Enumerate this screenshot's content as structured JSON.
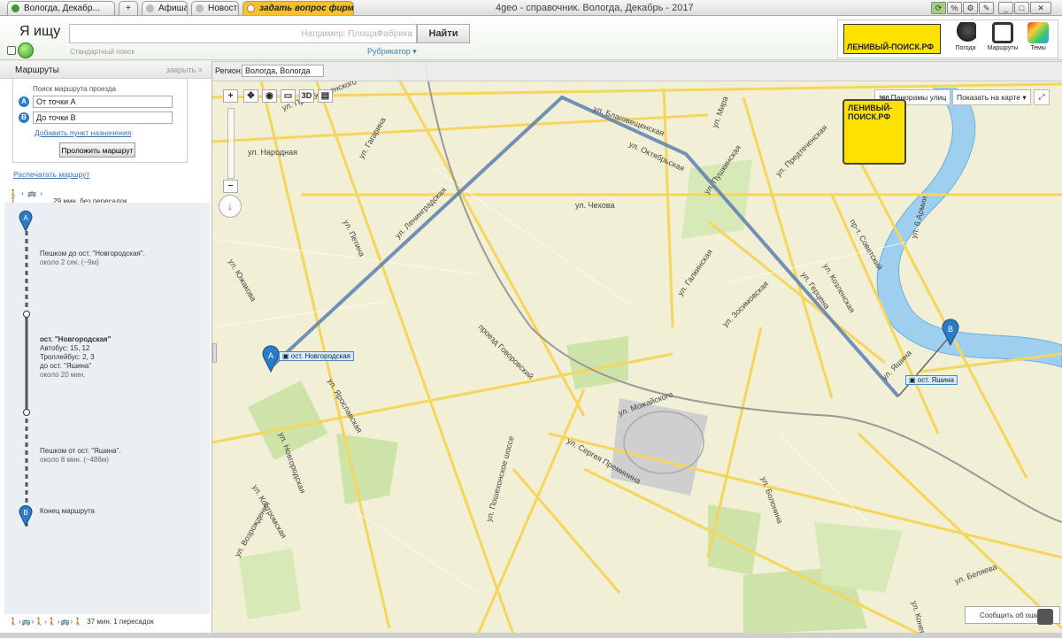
{
  "browser": {
    "tabs": [
      {
        "label": "Вологда, Декабр..."
      },
      {
        "label": "+"
      },
      {
        "label": "Афиша"
      },
      {
        "label": "Новости"
      },
      {
        "label": "задать вопрос фирмам"
      }
    ],
    "window_title": "4geo - справочник. Вологда, Декабрь - 2017"
  },
  "header": {
    "logo_text": "Я ищу",
    "search_placeholder": "Например: ПлощаФабрика",
    "find_label": "Найти",
    "standard_search_label": "Стандартный поиск",
    "rubricator_label": "Рубрикатор ▾",
    "banner_text": "ЛЕНИВЫЙ-ПОИСК.РФ",
    "weather_label": "Погода",
    "routes_label": "Маршруты",
    "themes_label": "Темы"
  },
  "panel": {
    "title": "Маршруты",
    "close_label": "закрыть ×",
    "search_title": "Поиск маршрута проезда",
    "from_point": "От точки А",
    "to_point": "До точки В",
    "point_a": "A",
    "point_b": "B",
    "add_destination": "Добавить пункт назначения",
    "build_route": "Проложить маршрут",
    "print_route": "Распечатать маршрут",
    "summary_top": "29 мин. без пересадок",
    "summary_bottom": "37 мин. 1 пересадок",
    "icons_top": "🚶 › 🚌 › 🚶",
    "icons_bottom": "🚶›🚌›🚶›🚶›🚌›🚶",
    "steps": [
      {
        "title": "Пешком до ост. \"Новгородская\".",
        "sub": "около 2 сек. (~9м)"
      },
      {
        "title": "ост. \"Новгородская\"",
        "line1": "Автобус: 15, 12",
        "line2": "Троллейбус: 2, 3",
        "line3": "до ост. \"Яшина\"",
        "sub": "около 20 мин."
      },
      {
        "title": "Пешком от ост. \"Яшина\".",
        "sub": "около 8 мин. (~486м)"
      },
      {
        "title": "Конец маршрута"
      }
    ]
  },
  "map": {
    "region_label": "Регион:",
    "region_value": "Вологда, Вологда",
    "panorama_label": "Панорамы улиц",
    "show_on_map": "Показать на карте ▾",
    "zoom_in": "+",
    "zoom_out": "−",
    "btn_3d": "3D",
    "stop_a_label": "ост. Новгородская",
    "stop_b_label": "ост. Яшина",
    "ad_text": "ЛЕНИВЫЙ-ПОИСК.РФ",
    "feedback_label": "Сообщить об ошибке",
    "colors": {
      "route": "#5b7fb0",
      "river": "#9fcfee",
      "water_edge": "#6aaedc",
      "road": "#f5d65c",
      "park": "#cde3a8"
    },
    "streets": [
      "ул. Октябрьская",
      "ул. Благовещенская",
      "ул. Мира",
      "ул. Чехова",
      "ул. Ленинградская",
      "ул. Петина",
      "ул. Гагарина",
      "ул. Народная",
      "ул. Преображенского",
      "ул. Южакова",
      "ул. Новгородская",
      "ул. Ярославская",
      "ул. Можайского",
      "ул. Сергея Преминина",
      "ул. Пошехонское шоссе",
      "ул. Зосимовская",
      "ул. Предтеченская",
      "ул. Козленская",
      "пр-т. Советский",
      "ул. Герцена",
      "ул. Галкинская",
      "ул. Пушкинская",
      "ул. Болонина",
      "ул. Беляева",
      "ул. Конева",
      "ул. Костромская",
      "ул. Возрождения",
      "ул. Яшина",
      "ул. 6 Армии",
      "проезд Говоровский"
    ]
  }
}
